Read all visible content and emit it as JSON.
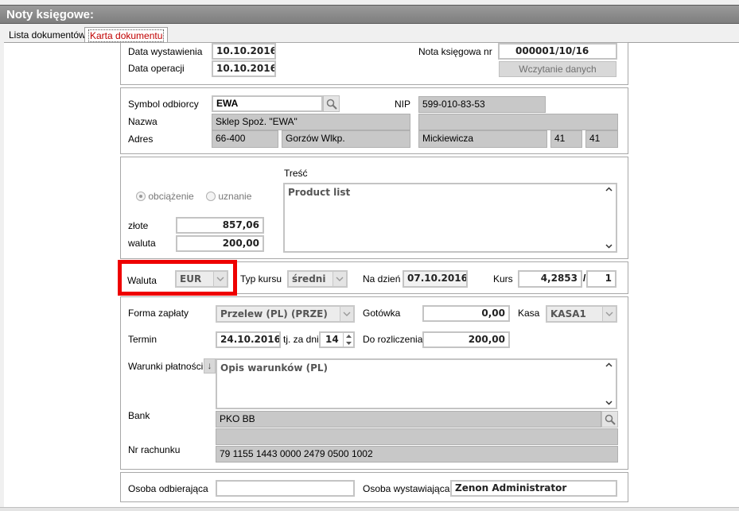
{
  "window": {
    "title": "Noty księgowe:"
  },
  "tabs": [
    {
      "label": "Lista dokumentów"
    },
    {
      "label": "Karta dokumentu"
    }
  ],
  "header": {
    "issue_date_label": "Data wystawienia",
    "issue_date": "10.10.2016",
    "operation_date_label": "Data operacji",
    "operation_date": "10.10.2016",
    "note_number_label": "Nota księgowa nr",
    "note_number": "000001/10/16",
    "load_data_button": "Wczytanie danych"
  },
  "recipient": {
    "symbol_label": "Symbol odbiorcy",
    "symbol": "EWA",
    "nip_label": "NIP",
    "nip": "599-010-83-53",
    "name_label": "Nazwa",
    "name": "Sklep Spoż. \"EWA\"",
    "address_label": "Adres",
    "postal_code": "66-400",
    "city": "Gorzów Wlkp.",
    "street": "Mickiewicza",
    "house_number": "41",
    "flat_number": "41"
  },
  "content": {
    "charge_label": "obciążenie",
    "credit_label": "uznanie",
    "selected": "charge",
    "pln_label": "złote",
    "pln_value": "857,06",
    "currency_amount_label": "waluta",
    "currency_amount": "200,00",
    "text_label": "Treść",
    "text": "Product list"
  },
  "currency": {
    "currency_label": "Waluta",
    "currency": "EUR",
    "rate_type_label": "Typ kursu",
    "rate_type": "średni",
    "date_label": "Na dzień",
    "date": "07.10.2016",
    "rate_label": "Kurs",
    "rate": "4,2853",
    "rate_separator": "/",
    "rate_unit": "1"
  },
  "payment": {
    "method_label": "Forma zapłaty",
    "method": "Przelew (PL)  (PRZE)",
    "cash_label": "Gotówka",
    "cash": "0,00",
    "register_label": "Kasa",
    "register": "KASA1",
    "due_label": "Termin",
    "due_date": "24.10.2016",
    "days_label": "tj. za dni",
    "days": "14",
    "to_settle_label": "Do rozliczenia",
    "to_settle": "200,00",
    "terms_label": "Warunki płatności",
    "terms": "Opis warunków (PL)",
    "bank_label": "Bank",
    "bank": "PKO BB",
    "account_label": "Nr rachunku",
    "account": "79 1155 1443 0000 2479 0500 1002"
  },
  "footer": {
    "receiver_label": "Osoba odbierająca",
    "receiver": "",
    "issuer_label": "Osoba wystawiająca",
    "issuer": "Zenon Administrator"
  }
}
